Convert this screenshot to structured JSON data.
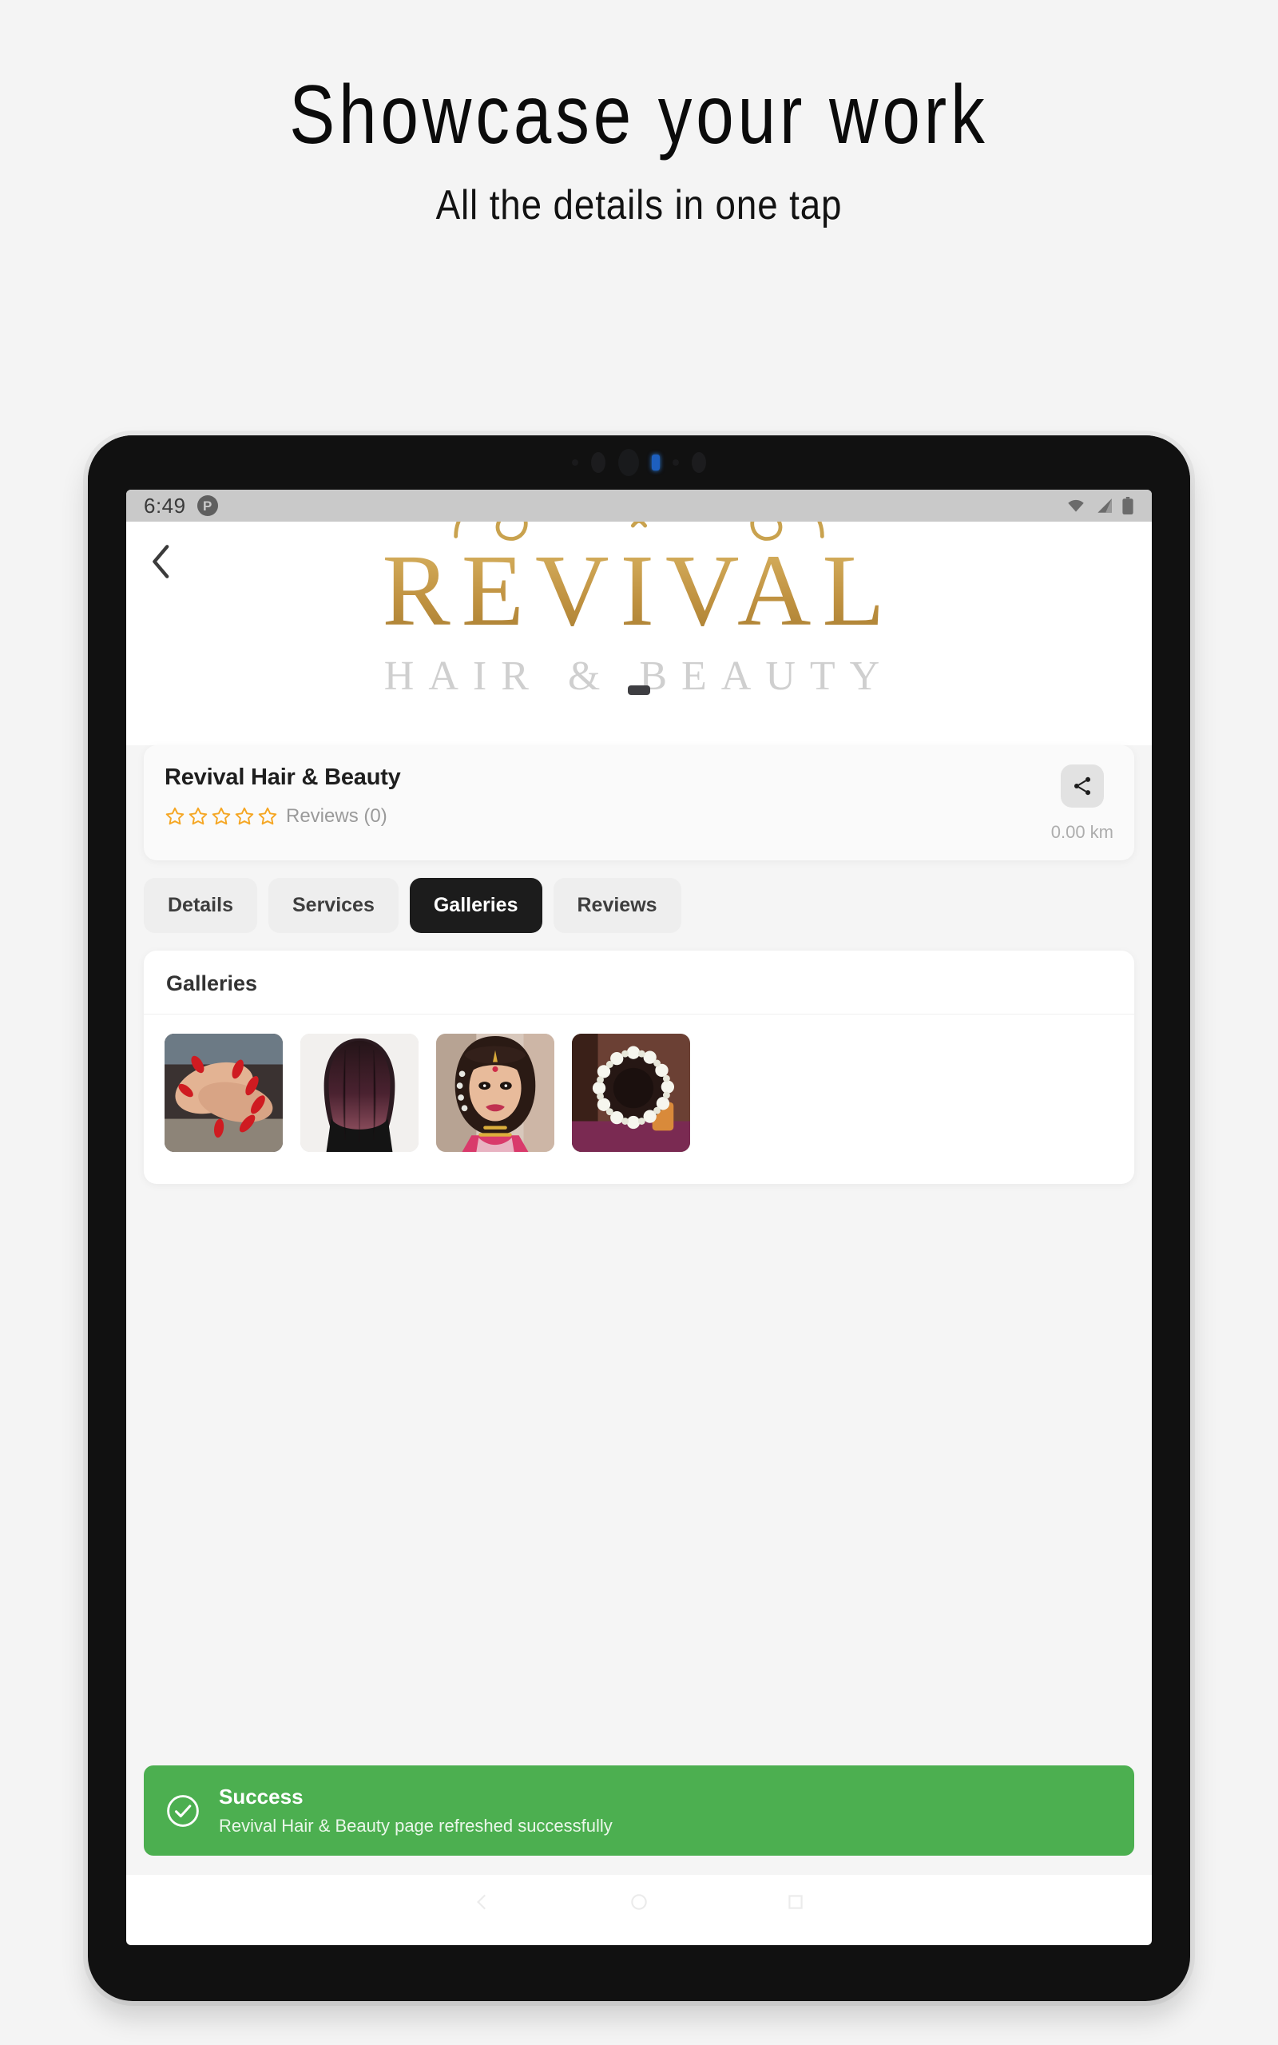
{
  "promo": {
    "title": "Showcase your work",
    "subtitle": "All the details in one tap"
  },
  "statusbar": {
    "time": "6:49",
    "badge_letter": "P",
    "icons": [
      "wifi-icon",
      "cellular-signal-icon",
      "battery-icon"
    ]
  },
  "hero": {
    "back_icon": "chevron-left-icon",
    "logo_word": "REVIVAL",
    "logo_subtitle": "HAIR & BEAUTY",
    "logo_color": "#c49b4a"
  },
  "info_card": {
    "business_name": "Revival Hair & Beauty",
    "rating_value": 0,
    "star_count": 5,
    "star_color": "#f5a623",
    "reviews_label": "Reviews (0)",
    "share_icon": "share-icon",
    "distance": "0.00 km"
  },
  "tabs": [
    {
      "label": "Details",
      "active": false
    },
    {
      "label": "Services",
      "active": false
    },
    {
      "label": "Galleries",
      "active": true
    },
    {
      "label": "Reviews",
      "active": false
    }
  ],
  "galleries": {
    "section_title": "Galleries",
    "items": [
      {
        "name": "red-nails-manicure-photo"
      },
      {
        "name": "hair-colour-back-view-photo"
      },
      {
        "name": "bridal-makeup-portrait-photo"
      },
      {
        "name": "floral-bun-hairstyle-photo"
      }
    ]
  },
  "toast": {
    "icon": "check-circle-icon",
    "title": "Success",
    "message": "Revival Hair & Beauty page refreshed successfully",
    "color": "#4caf50"
  },
  "navbar": {
    "items": [
      "back-gesture-icon",
      "home-gesture-icon",
      "recents-gesture-icon"
    ]
  }
}
